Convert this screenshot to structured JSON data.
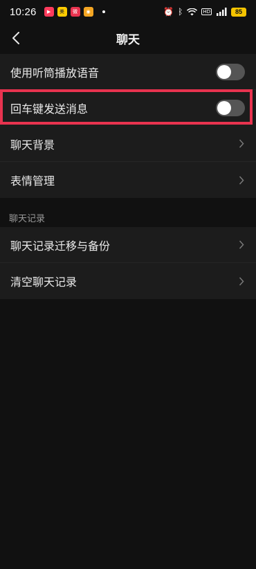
{
  "status": {
    "time": "10:26",
    "battery": "85",
    "hd": "HD",
    "apps": [
      {
        "icon": "video-app-icon",
        "color": "#ff3b5c"
      },
      {
        "icon": "meituan-app-icon",
        "color": "#ffcc00"
      },
      {
        "icon": "weibo-red-app-icon",
        "color": "#e8334f"
      },
      {
        "icon": "weibo-app-icon",
        "color": "#f5a623"
      }
    ]
  },
  "nav": {
    "title": "聊天"
  },
  "settings": {
    "voice_playback": {
      "label": "使用听筒播放语音",
      "enabled": false
    },
    "enter_to_send": {
      "label": "回车键发送消息",
      "enabled": false
    },
    "chat_background": {
      "label": "聊天背景"
    },
    "sticker_management": {
      "label": "表情管理"
    }
  },
  "history": {
    "header": "聊天记录",
    "migrate": {
      "label": "聊天记录迁移与备份"
    },
    "clear": {
      "label": "清空聊天记录"
    }
  },
  "colors": {
    "background": "#111111",
    "row_background": "#1c1c1c",
    "highlight": "#e8334f",
    "toggle_off": "#555555"
  }
}
